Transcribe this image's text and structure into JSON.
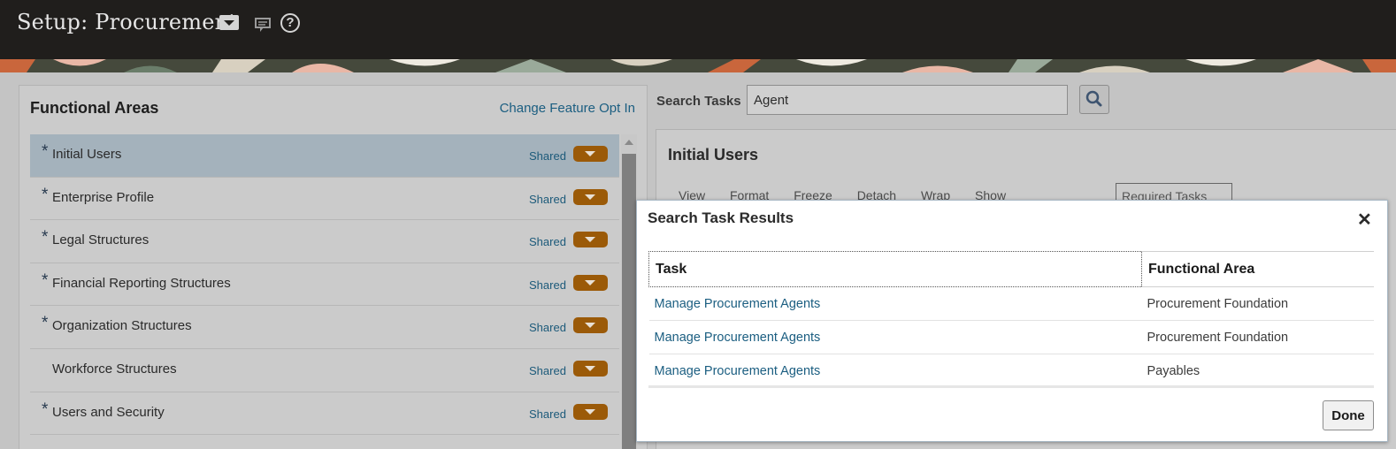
{
  "header": {
    "title": "Setup: Procurement",
    "icons": [
      "dropdown-menu-icon",
      "chat-icon",
      "help-icon"
    ],
    "help_glyph": "?"
  },
  "functional_areas": {
    "title": "Functional Areas",
    "change_link": "Change Feature Opt In",
    "items": [
      {
        "label": "Initial Users",
        "required": true,
        "shared": "Shared",
        "selected": true
      },
      {
        "label": "Enterprise Profile",
        "required": true,
        "shared": "Shared"
      },
      {
        "label": "Legal Structures",
        "required": true,
        "shared": "Shared"
      },
      {
        "label": "Financial Reporting Structures",
        "required": true,
        "shared": "Shared"
      },
      {
        "label": "Organization Structures",
        "required": true,
        "shared": "Shared"
      },
      {
        "label": "Workforce Structures",
        "required": false,
        "shared": "Shared"
      },
      {
        "label": "Users and Security",
        "required": true,
        "shared": "Shared"
      }
    ],
    "required_marker": "*"
  },
  "search": {
    "label": "Search Tasks",
    "value": "Agent"
  },
  "task_panel": {
    "title": "Initial Users",
    "toolbar": [
      "View",
      "Format",
      "Freeze",
      "Detach",
      "Wrap",
      "Show"
    ],
    "show_value": "Required Tasks"
  },
  "dialog": {
    "title": "Search Task Results",
    "close_glyph": "✕",
    "columns": {
      "task": "Task",
      "area": "Functional Area"
    },
    "rows": [
      {
        "task": "Manage Procurement Agents",
        "area": "Procurement Foundation"
      },
      {
        "task": "Manage Procurement Agents",
        "area": "Procurement Foundation"
      },
      {
        "task": "Manage Procurement Agents",
        "area": "Payables"
      }
    ],
    "done_label": "Done"
  },
  "colors": {
    "header_bg": "#201e1c",
    "link": "#1b5e81",
    "pill": "#9b5a08"
  }
}
